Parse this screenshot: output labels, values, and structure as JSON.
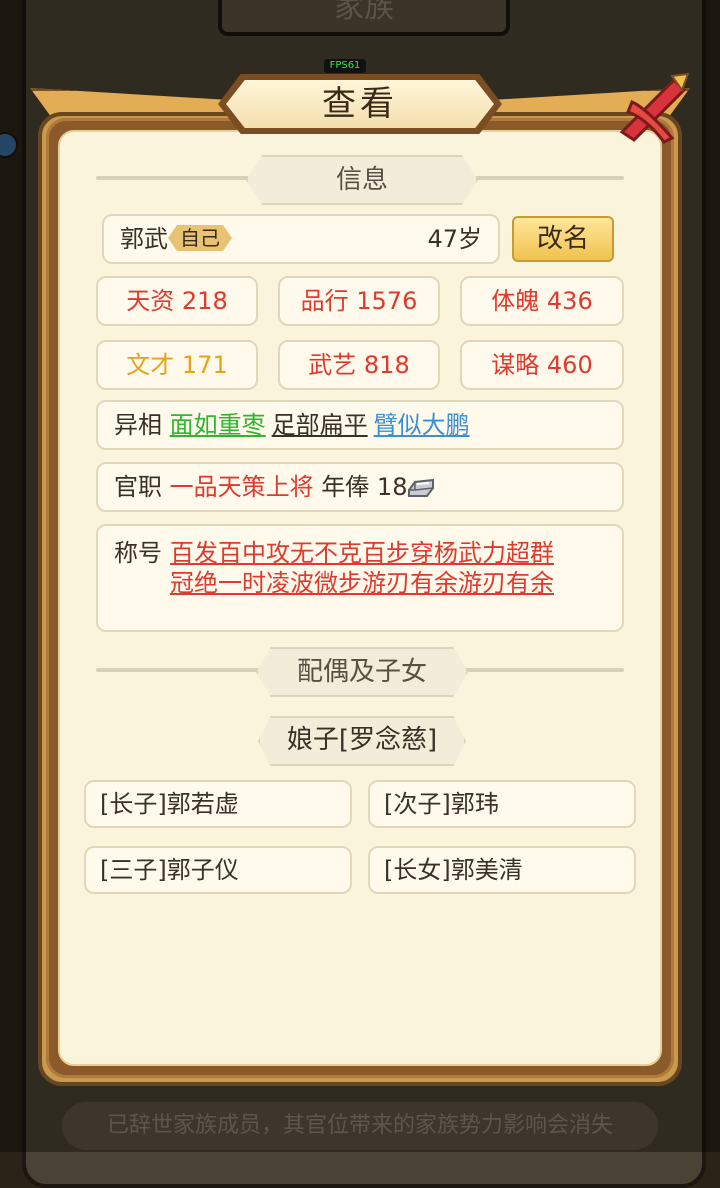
{
  "background": {
    "title": "家族",
    "footer_note": "已辞世家族成员，其官位带来的家族势力影响会消失"
  },
  "fps": "FPS61",
  "dialog": {
    "title": "查看"
  },
  "info_section": {
    "header": "信息"
  },
  "member": {
    "name": "郭武",
    "self_tag": "自己",
    "age": "47岁",
    "rename_label": "改名"
  },
  "stats": [
    {
      "label": "天资 218",
      "color": "#e03a2e"
    },
    {
      "label": "品行 1576",
      "color": "#e03a2e"
    },
    {
      "label": "体魄 436",
      "color": "#e03a2e"
    },
    {
      "label": "文才 171",
      "color": "#e8a21a"
    },
    {
      "label": "武艺 818",
      "color": "#e03a2e"
    },
    {
      "label": "谋略 460",
      "color": "#e03a2e"
    }
  ],
  "appearance": {
    "label": "异相",
    "trait1": "面如重枣",
    "trait2": "足部扁平",
    "trait3": "臂似大鹏"
  },
  "office": {
    "label": "官职",
    "title": "一品天策上将",
    "salary_label": "年俸",
    "salary_value": "18"
  },
  "honors": {
    "label": "称号",
    "line1": "百发百中攻无不克百步穿杨武力超群",
    "line2": "冠绝一时凌波微步游刃有余游刃有余"
  },
  "family_section": {
    "header": "配偶及子女"
  },
  "spouse": "娘子[罗念慈]",
  "children": [
    "[长子]郭若虚",
    "[次子]郭玮",
    "[三子]郭子仪",
    "[长女]郭美清"
  ]
}
